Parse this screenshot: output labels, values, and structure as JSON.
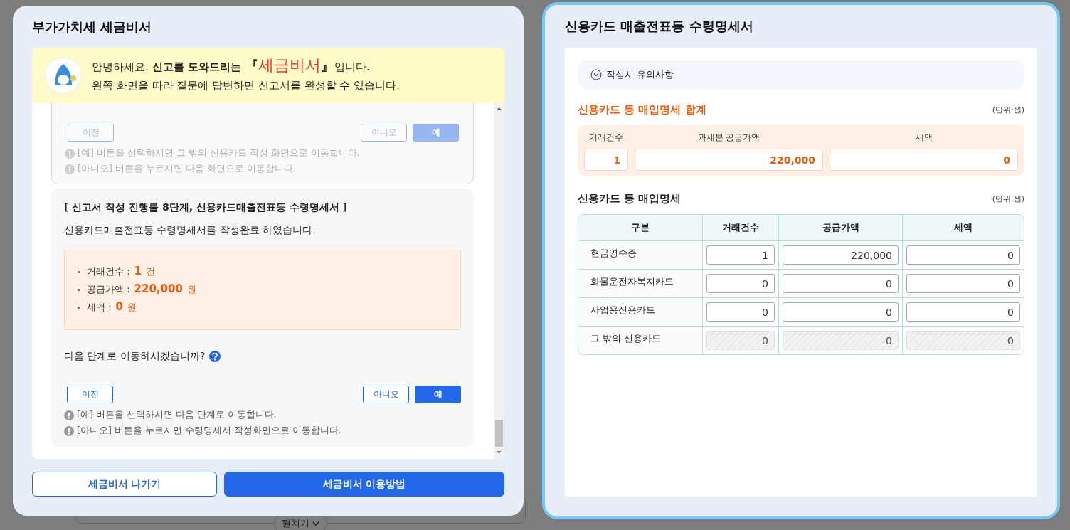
{
  "backdrop": {
    "expand_button": "펼치기"
  },
  "assistant": {
    "title": "부가가치세 세금비서",
    "banner": {
      "line1": [
        {
          "kind": "plain",
          "text": "안녕하세요. "
        },
        {
          "kind": "bold",
          "text": "신고를 도와드리는 "
        },
        {
          "kind": "bracket",
          "text": "『"
        },
        {
          "kind": "brand",
          "text": "세금비서"
        },
        {
          "kind": "bracket",
          "text": "』"
        },
        {
          "kind": "plain",
          "text": "입니다."
        }
      ],
      "line2": "왼쪽 화면을 따라 질문에 답변하면 신고서를 완성할 수 있습니다."
    },
    "steps": [
      {
        "faded": true,
        "buttons": [
          {
            "kind": "prev",
            "label": "이전"
          },
          {
            "kind": "no",
            "label": "아니오"
          },
          {
            "kind": "yes",
            "label": "예"
          }
        ],
        "notes": [
          "[예] 버튼을 선택하시면 그 밖의 신용카드 작성 화면으로 이동합니다.",
          "[아니오] 버튼을 누르시면 다음 화면으로 이동합니다."
        ]
      },
      {
        "faded": false,
        "heading": "[ 신고서 작성 진행률 8단계, 신용카드매출전표등 수령명세서 ]",
        "message": "신용카드매출전표등 수령명세서를 작성완료 하였습니다.",
        "summary": [
          {
            "label": "거래건수 :",
            "value": "1",
            "unit": "건"
          },
          {
            "label": "공급가액 :",
            "value": "220,000",
            "unit": "원"
          },
          {
            "label": "세액 :",
            "value": "0",
            "unit": "원"
          }
        ],
        "question": "다음 단계로 이동하시겠습니까?",
        "buttons": [
          {
            "kind": "prev",
            "label": "이전"
          },
          {
            "kind": "no",
            "label": "아니오"
          },
          {
            "kind": "yes",
            "label": "예"
          }
        ],
        "notes": [
          "[예] 버튼을 선택하시면 다음 단계로 이동합니다.",
          "[아니오] 버튼을 누르시면 수령명세서 작성화면으로 이동합니다."
        ]
      }
    ],
    "footer": [
      {
        "kind": "outline",
        "label": "세금비서 나가기"
      },
      {
        "kind": "primary",
        "label": "세금비서 이용방법"
      }
    ]
  },
  "form": {
    "title": "신용카드 매출전표등 수령명세서",
    "notice": {
      "label": "작성시 유의사항",
      "expanded": false
    },
    "total": {
      "title": "신용카드 등 매입명세 합계",
      "unit": "(단위:원)",
      "fields": [
        {
          "label": "거래건수",
          "value": "1"
        },
        {
          "label": "과세분 공급가액",
          "value": "220,000"
        },
        {
          "label": "세액",
          "value": "0"
        }
      ]
    },
    "detail": {
      "title": "신용카드 등 매입명세",
      "unit": "(단위:원)",
      "columns": [
        "구분",
        "거래건수",
        "공급가액",
        "세액"
      ],
      "rows": [
        {
          "label": "현금영수증",
          "values": [
            "1",
            "220,000",
            "0"
          ],
          "disabled": false
        },
        {
          "label": "화물운전자복지카드",
          "values": [
            "0",
            "0",
            "0"
          ],
          "disabled": false
        },
        {
          "label": "사업용신용카드",
          "values": [
            "0",
            "0",
            "0"
          ],
          "disabled": false
        },
        {
          "label": "그 밖의 신용카드",
          "values": [
            "0",
            "0",
            "0"
          ],
          "disabled": true
        }
      ]
    }
  }
}
